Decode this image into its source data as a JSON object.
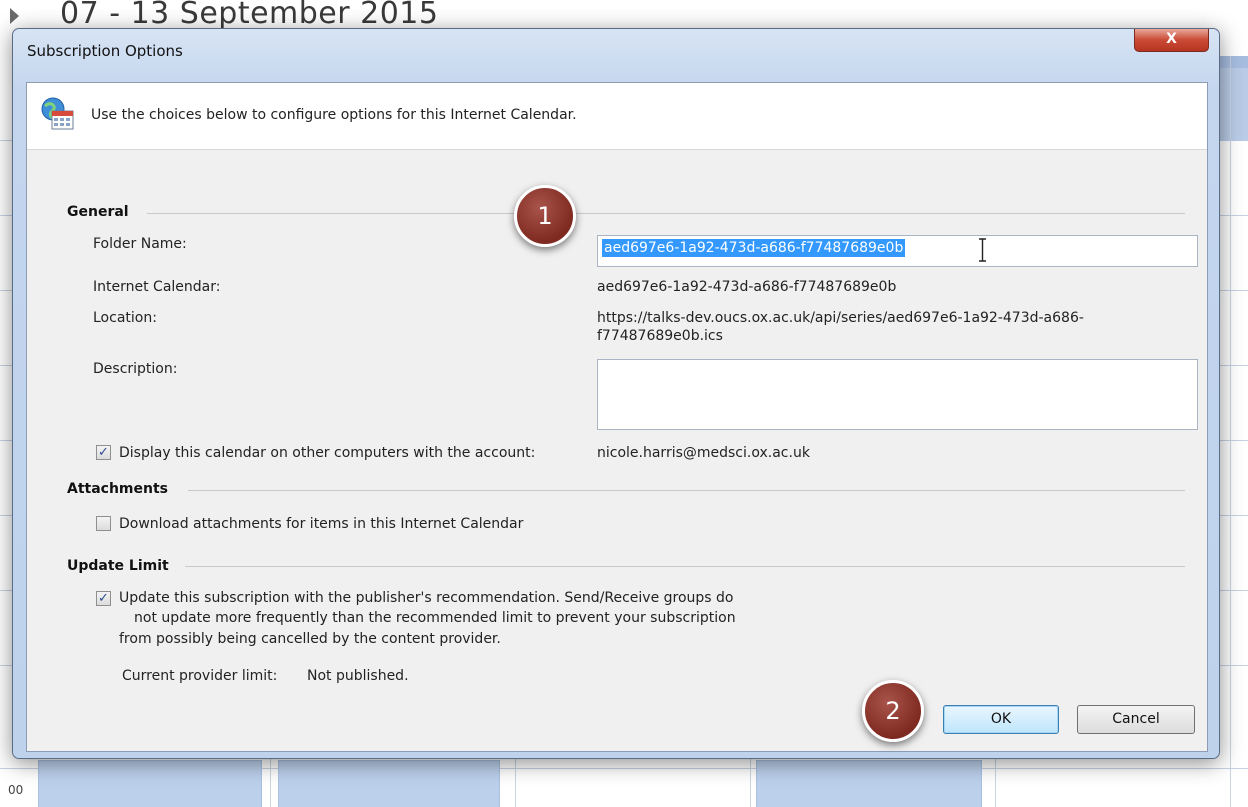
{
  "background": {
    "week_title": "07 - 13 September 2015",
    "time_label": "00"
  },
  "dialog": {
    "title": "Subscription Options",
    "close_label": "X",
    "header_text": "Use the choices below to configure options for this Internet Calendar.",
    "general": {
      "section_title": "General",
      "folder_name_label": "Folder Name:",
      "folder_name_value": "aed697e6-1a92-473d-a686-f77487689e0b",
      "internet_calendar_label": "Internet Calendar:",
      "internet_calendar_value": "aed697e6-1a92-473d-a686-f77487689e0b",
      "location_label": "Location:",
      "location_line1": "https://talks-dev.oucs.ox.ac.uk/api/series/aed697e6-1a92-473d-a686-",
      "location_line2": "f77487689e0b.ics",
      "description_label": "Description:",
      "description_value": "",
      "display_checkbox_label": "Display this calendar on other computers with the account:",
      "display_checked": true,
      "account_value": "nicole.harris@medsci.ox.ac.uk"
    },
    "attachments": {
      "section_title": "Attachments",
      "download_label": "Download attachments for items in this Internet Calendar",
      "download_checked": false
    },
    "update_limit": {
      "section_title": "Update Limit",
      "update_line1": "Update this subscription with the publisher's recommendation. Send/Receive groups do",
      "update_line2": "not update more frequently than the recommended limit to prevent your subscription",
      "update_line3": "from possibly being cancelled by the content provider.",
      "update_checked": true,
      "provider_limit_label": "Current provider limit:",
      "provider_limit_value": "Not published."
    },
    "buttons": {
      "ok": "OK",
      "cancel": "Cancel"
    },
    "annotations": {
      "step1": "1",
      "step2": "2"
    }
  },
  "colors": {
    "selection": "#3399ff",
    "badge": "#7f2a21",
    "close_button": "#c94a35"
  }
}
